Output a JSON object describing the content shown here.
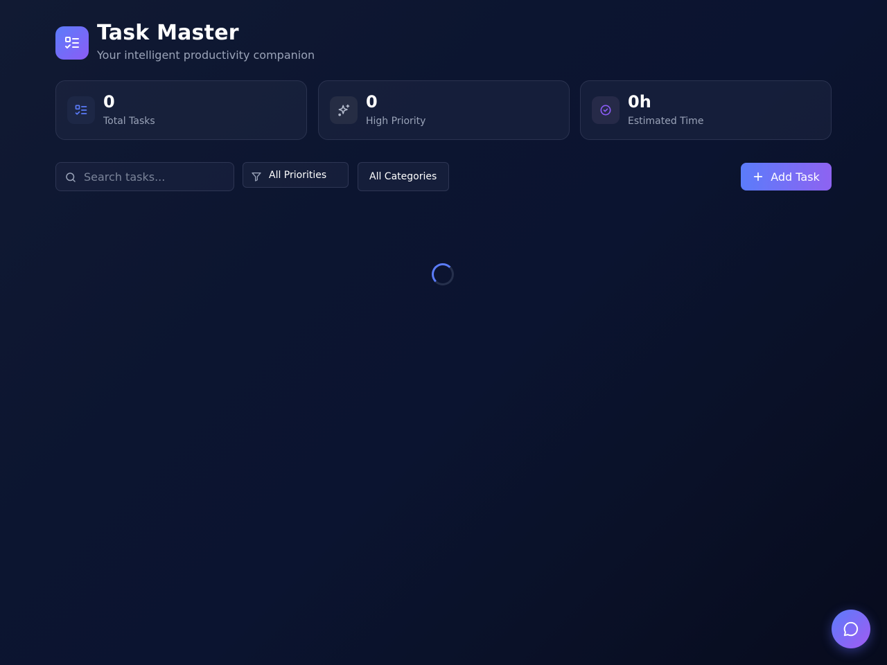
{
  "header": {
    "title": "Task Master",
    "subtitle": "Your intelligent productivity companion",
    "logo_icon": "checklist-icon"
  },
  "stats": [
    {
      "value": "0",
      "label": "Total Tasks",
      "icon": "list-icon",
      "icon_color": "#5b7cfa"
    },
    {
      "value": "0",
      "label": "High Priority",
      "icon": "sparkles-icon",
      "icon_color": "#b8bfd0"
    },
    {
      "value": "0h",
      "label": "Estimated Time",
      "icon": "check-circle-icon",
      "icon_color": "#8b5cf6"
    }
  ],
  "toolbar": {
    "search_placeholder": "Search tasks...",
    "priority_filter": "All Priorities",
    "category_filter": "All Categories",
    "add_label": "Add Task"
  },
  "status": {
    "loading": true
  },
  "colors": {
    "accent": "#5b7cfa",
    "accent_secondary": "#8b5cf6",
    "background": "#0b1430",
    "muted_text": "#9aa3b8"
  },
  "chat": {
    "icon": "chat-bubble-icon"
  }
}
